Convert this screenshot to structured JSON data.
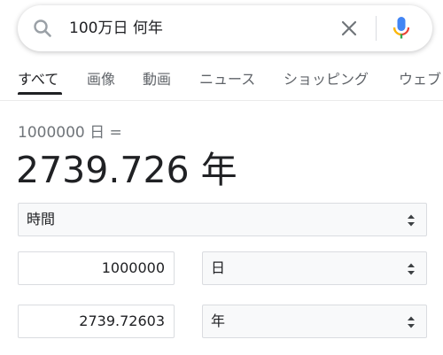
{
  "search": {
    "query": "100万日 何年"
  },
  "tabs": [
    {
      "label": "すべて"
    },
    {
      "label": "画像"
    },
    {
      "label": "動画"
    },
    {
      "label": "ニュース"
    },
    {
      "label": "ショッピング"
    },
    {
      "label": "ウェブ"
    }
  ],
  "converter": {
    "expression": "1000000 日 =",
    "result": "2739.726 年",
    "category": "時間",
    "from_value": "1000000",
    "from_unit": "日",
    "to_value": "2739.72603",
    "to_unit": "年"
  },
  "colors": {
    "mic_blue": "#4285f4",
    "mic_red": "#ea4335",
    "mic_yellow": "#fbbc04",
    "mic_green": "#34a853"
  }
}
